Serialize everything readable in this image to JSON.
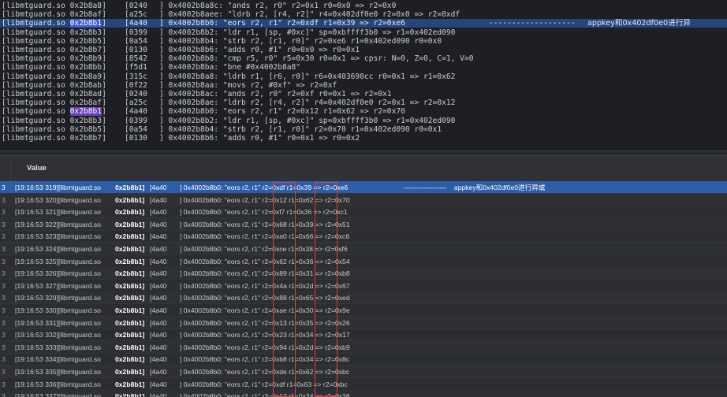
{
  "log_rows": [
    {
      "lib": "[libmtguard.so 0x2b8a8]",
      "id": "[0240",
      "addr": "] 0x4002b8a8c: \"ands r2, r0\" r2=0x1 r0=0x0 => r2=0x0",
      "addr_part": "0x2b8a8",
      "hl": ""
    },
    {
      "lib": "[libmtguard.so 0x2b8af]",
      "id": "[a25c",
      "addr": "] 0x4002b8aee: \"ldrb r2, [r4, r2]\" r4=0x402df0e0 r2=0x0 => r2=0xdf",
      "addr_part": "0x2b8af",
      "hl": ""
    },
    {
      "lib": "[libmtguard.so 0x2b8b1]",
      "id": "[4a40",
      "addr": "] 0x4002b8b0: \"eors r2, r1\" r2=0xdf r1=0x39 => r2=0xe6",
      "addr_part": "0x2b8b1",
      "hl": "hl",
      "comment": "-------------------",
      "comment2": "appkey和0x402df0e0进行异"
    },
    {
      "lib": "[libmtguard.so 0x2b8b3]",
      "id": "[0399",
      "addr": "] 0x4002b8b2: \"ldr r1, [sp, #0xc]\" sp=0xbffff3b0 => r1=0x402ed090",
      "addr_part": "0x2b8b3",
      "hl": ""
    },
    {
      "lib": "[libmtguard.so 0x2b8b5]",
      "id": "[0a54",
      "addr": "] 0x4002b8b4: \"strb r2, [r1, r0]\" r2=0xe6 r1=0x402ed090 r0=0x0",
      "addr_part": "0x2b8b5",
      "hl": ""
    },
    {
      "lib": "[libmtguard.so 0x2b8b7]",
      "id": "[0130",
      "addr": "] 0x4002b8b6: \"adds r0, #1\" r0=0x0 => r0=0x1",
      "addr_part": "0x2b8b7",
      "hl": ""
    },
    {
      "lib": "[libmtguard.so 0x2b8b9]",
      "id": "[8542",
      "addr": "] 0x4002b8b8: \"cmp r5, r0\" r5=0x30 r0=0x1 => cpsr: N=0, Z=0, C=1, V=0",
      "addr_part": "0x2b8b9",
      "hl": ""
    },
    {
      "lib": "[libmtguard.so 0x2b8bb]",
      "id": "[f5d1",
      "addr": "] 0x4002b8ba: \"bne #0x4002b8a8\"",
      "addr_part": "0x2b8bb",
      "hl": ""
    },
    {
      "lib": "[libmtguard.so 0x2b8a9]",
      "id": "[315c",
      "addr": "] 0x4002b8a8: \"ldrb r1, [r6, r0]\" r6=0x403690cc r0=0x1 => r1=0x62",
      "addr_part": "0x2b8a9",
      "hl": ""
    },
    {
      "lib": "[libmtguard.so 0x2b8ab]",
      "id": "[0f22",
      "addr": "] 0x4002b8aa: \"movs r2, #0xf\" => r2=0xf",
      "addr_part": "0x2b8ab",
      "hl": ""
    },
    {
      "lib": "[libmtguard.so 0x2b8ad]",
      "id": "[0240",
      "addr": "] 0x4002b8ac: \"ands r2, r0\" r2=0xf r0=0x1 => r2=0x1",
      "addr_part": "0x2b8ad",
      "hl": ""
    },
    {
      "lib": "[libmtguard.so 0x2b8af]",
      "id": "[a25c",
      "addr": "] 0x4002b8ae: \"ldrb r2, [r4, r2]\" r4=0x402df0e0 r2=0x1 => r2=0x12",
      "addr_part": "0x2b8af",
      "hl": ""
    },
    {
      "lib": "[libmtguard.so 0x2b8b1]",
      "id": "[4a40",
      "addr": "] 0x4002b8b0: \"eors r2, r1\" r2=0x12 r1=0x62 => r2=0x70",
      "addr_part": "0x2b8b1",
      "hl": "hlp"
    },
    {
      "lib": "[libmtguard.so 0x2b8b3]",
      "id": "[0399",
      "addr": "] 0x4002b8b2: \"ldr r1, [sp, #0xc]\" sp=0xbffff3b0 => r1=0x402ed090",
      "addr_part": "0x2b8b3",
      "hl": ""
    },
    {
      "lib": "[libmtguard.so 0x2b8b5]",
      "id": "[0a54",
      "addr": "] 0x4002b8b4: \"strb r2, [r1, r0]\" r2=0x70 r1=0x402ed090 r0=0x1",
      "addr_part": "0x2b8b5",
      "hl": ""
    },
    {
      "lib": "[libmtguard.so 0x2b8b7]",
      "id": "[0130",
      "addr": "] 0x4002b8b6: \"adds r0, #1\" r0=0x1 => r0=0x2",
      "addr_part": "0x2b8b7",
      "hl": ""
    }
  ],
  "table": {
    "header_value": "Value",
    "rows": [
      {
        "ts": "[19:16:53 319][libmtguard.so",
        "addr": "0x2b8b1]",
        "id": "[4a40",
        "ins": "] 0x4002b8b0: \"eors r2, r1\" r2=0xdf r1=0x39 => r2=0xe6",
        "cmt": "-------------------    appkey和0x402df0e0进行异或"
      },
      {
        "ts": "[19:16:53 320][libmtguard.so",
        "addr": "0x2b8b1]",
        "id": "[4a40",
        "ins": "] 0x4002b8b0: \"eors r2, r1\" r2=0x12 r1=0x62 => r2=0x70",
        "cmt": ""
      },
      {
        "ts": "[19:16:53 321][libmtguard.so",
        "addr": "0x2b8b1]",
        "id": "[4a40",
        "ins": "] 0x4002b8b0: \"eors r2, r1\" r2=0xf7 r1=0x36 => r2=0xc1",
        "cmt": ""
      },
      {
        "ts": "[19:16:53 322][libmtguard.so",
        "addr": "0x2b8b1]",
        "id": "[4a40",
        "ins": "] 0x4002b8b0: \"eors r2, r1\" r2=0x68 r1=0x39 => r2=0x51",
        "cmt": ""
      },
      {
        "ts": "[19:16:53 323][libmtguard.so",
        "addr": "0x2b8b1]",
        "id": "[4a40",
        "ins": "] 0x4002b8b0: \"eors r2, r1\" r2=0xa0 r1=0x66 => r2=0xc6",
        "cmt": ""
      },
      {
        "ts": "[19:16:53 324][libmtguard.so",
        "addr": "0x2b8b1]",
        "id": "[4a40",
        "ins": "] 0x4002b8b0: \"eors r2, r1\" r2=0xce r1=0x38 => r2=0xf6",
        "cmt": ""
      },
      {
        "ts": "[19:16:53 325][libmtguard.so",
        "addr": "0x2b8b1]",
        "id": "[4a40",
        "ins": "] 0x4002b8b0: \"eors r2, r1\" r2=0x62 r1=0x36 => r2=0x54",
        "cmt": ""
      },
      {
        "ts": "[19:16:53 326][libmtguard.so",
        "addr": "0x2b8b1]",
        "id": "[4a40",
        "ins": "] 0x4002b8b0: \"eors r2, r1\" r2=0x89 r1=0x31 => r2=0xb8",
        "cmt": ""
      },
      {
        "ts": "[19:16:53 327][libmtguard.so",
        "addr": "0x2b8b1]",
        "id": "[4a40",
        "ins": "] 0x4002b8b0: \"eors r2, r1\" r2=0x4a r1=0x2d => r2=0x67",
        "cmt": ""
      },
      {
        "ts": "[19:16:53 329][libmtguard.so",
        "addr": "0x2b8b1]",
        "id": "[4a40",
        "ins": "] 0x4002b8b0: \"eors r2, r1\" r2=0x88 r1=0x65 => r2=0xed",
        "cmt": ""
      },
      {
        "ts": "[19:16:53 330][libmtguard.so",
        "addr": "0x2b8b1]",
        "id": "[4a40",
        "ins": "] 0x4002b8b0: \"eors r2, r1\" r2=0xae r1=0x30 => r2=0x9e",
        "cmt": ""
      },
      {
        "ts": "[19:16:53 331][libmtguard.so",
        "addr": "0x2b8b1]",
        "id": "[4a40",
        "ins": "] 0x4002b8b0: \"eors r2, r1\" r2=0x13 r1=0x35 => r2=0x26",
        "cmt": ""
      },
      {
        "ts": "[19:16:53 332][libmtguard.so",
        "addr": "0x2b8b1]",
        "id": "[4a40",
        "ins": "] 0x4002b8b0: \"eors r2, r1\" r2=0x23 r1=0x34 => r2=0x17",
        "cmt": ""
      },
      {
        "ts": "[19:16:53 333][libmtguard.so",
        "addr": "0x2b8b1]",
        "id": "[4a40",
        "ins": "] 0x4002b8b0: \"eors r2, r1\" r2=0x94 r1=0x2d => r2=0xb9",
        "cmt": ""
      },
      {
        "ts": "[19:16:53 334][libmtguard.so",
        "addr": "0x2b8b1]",
        "id": "[4a40",
        "ins": "] 0x4002b8b0: \"eors r2, r1\" r2=0xb8 r1=0x34 => r2=0x8c",
        "cmt": ""
      },
      {
        "ts": "[19:16:53 335][libmtguard.so",
        "addr": "0x2b8b1]",
        "id": "[4a40",
        "ins": "] 0x4002b8b0: \"eors r2, r1\" r2=0xde r1=0x62 => r2=0xbc",
        "cmt": ""
      },
      {
        "ts": "[19:16:53 336][libmtguard.so",
        "addr": "0x2b8b1]",
        "id": "[4a40",
        "ins": "] 0x4002b8b0: \"eors r2, r1\" r2=0xdf r1=0x63 => r2=0xbc",
        "cmt": ""
      },
      {
        "ts": "[19:16:53 337][libmtguard.so",
        "addr": "0x2b8b1]",
        "id": "[4a40",
        "ins": "] 0x4002b8b0: \"eors r2, r1\" r2=0x12 r1=0x34 => r2=0x26",
        "cmt": ""
      }
    ],
    "row_index_label": "3"
  },
  "colors": {
    "selection": "#2e5da8",
    "highlight_box": "#d8443a",
    "addr_highlight": "#3d5fd1"
  }
}
